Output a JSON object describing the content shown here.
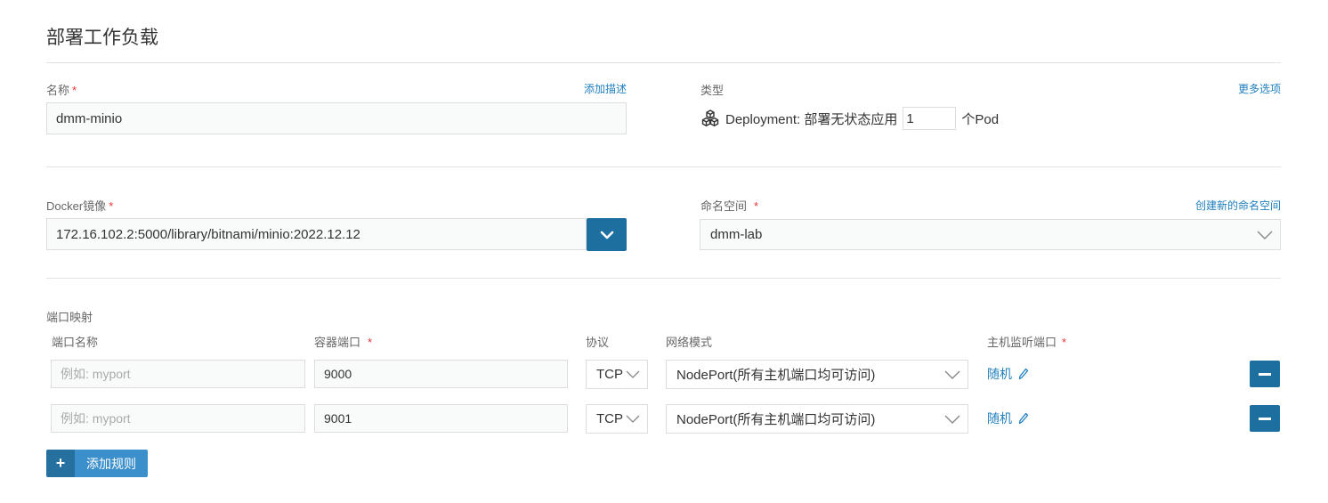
{
  "page": {
    "title": "部署工作负载"
  },
  "name_field": {
    "label": "名称",
    "required_mark": "*",
    "add_desc_link": "添加描述",
    "value": "dmm-minio"
  },
  "type_field": {
    "label": "类型",
    "more_options_link": "更多选项",
    "prefix": "Deployment: 部署无状态应用",
    "replicas": "1",
    "suffix": "个Pod",
    "icon": "cubes-icon"
  },
  "image_field": {
    "label": "Docker镜像",
    "required_mark": "*",
    "value": "172.16.102.2:5000/library/bitnami/minio:2022.12.12"
  },
  "namespace_field": {
    "label": "命名空间",
    "required_mark": "*",
    "create_link": "创建新的命名空间",
    "value": "dmm-lab"
  },
  "ports": {
    "section_label": "端口映射",
    "headers": {
      "name": "端口名称",
      "container_port": "容器端口",
      "container_port_required": "*",
      "protocol": "协议",
      "network_mode": "网络模式",
      "host_port": "主机监听端口",
      "host_port_required": "*"
    },
    "rows": [
      {
        "name_placeholder": "例如: myport",
        "container_port": "9000",
        "protocol": "TCP",
        "network_mode": "NodePort(所有主机端口均可访问)",
        "host_port": "随机"
      },
      {
        "name_placeholder": "例如: myport",
        "container_port": "9001",
        "protocol": "TCP",
        "network_mode": "NodePort(所有主机端口均可访问)",
        "host_port": "随机"
      }
    ],
    "add_rule_label": "添加规则"
  },
  "colors": {
    "primary": "#1d6f9f",
    "link": "#1f7fbf",
    "required": "#e33333",
    "add_button": "#3b8fcb"
  }
}
